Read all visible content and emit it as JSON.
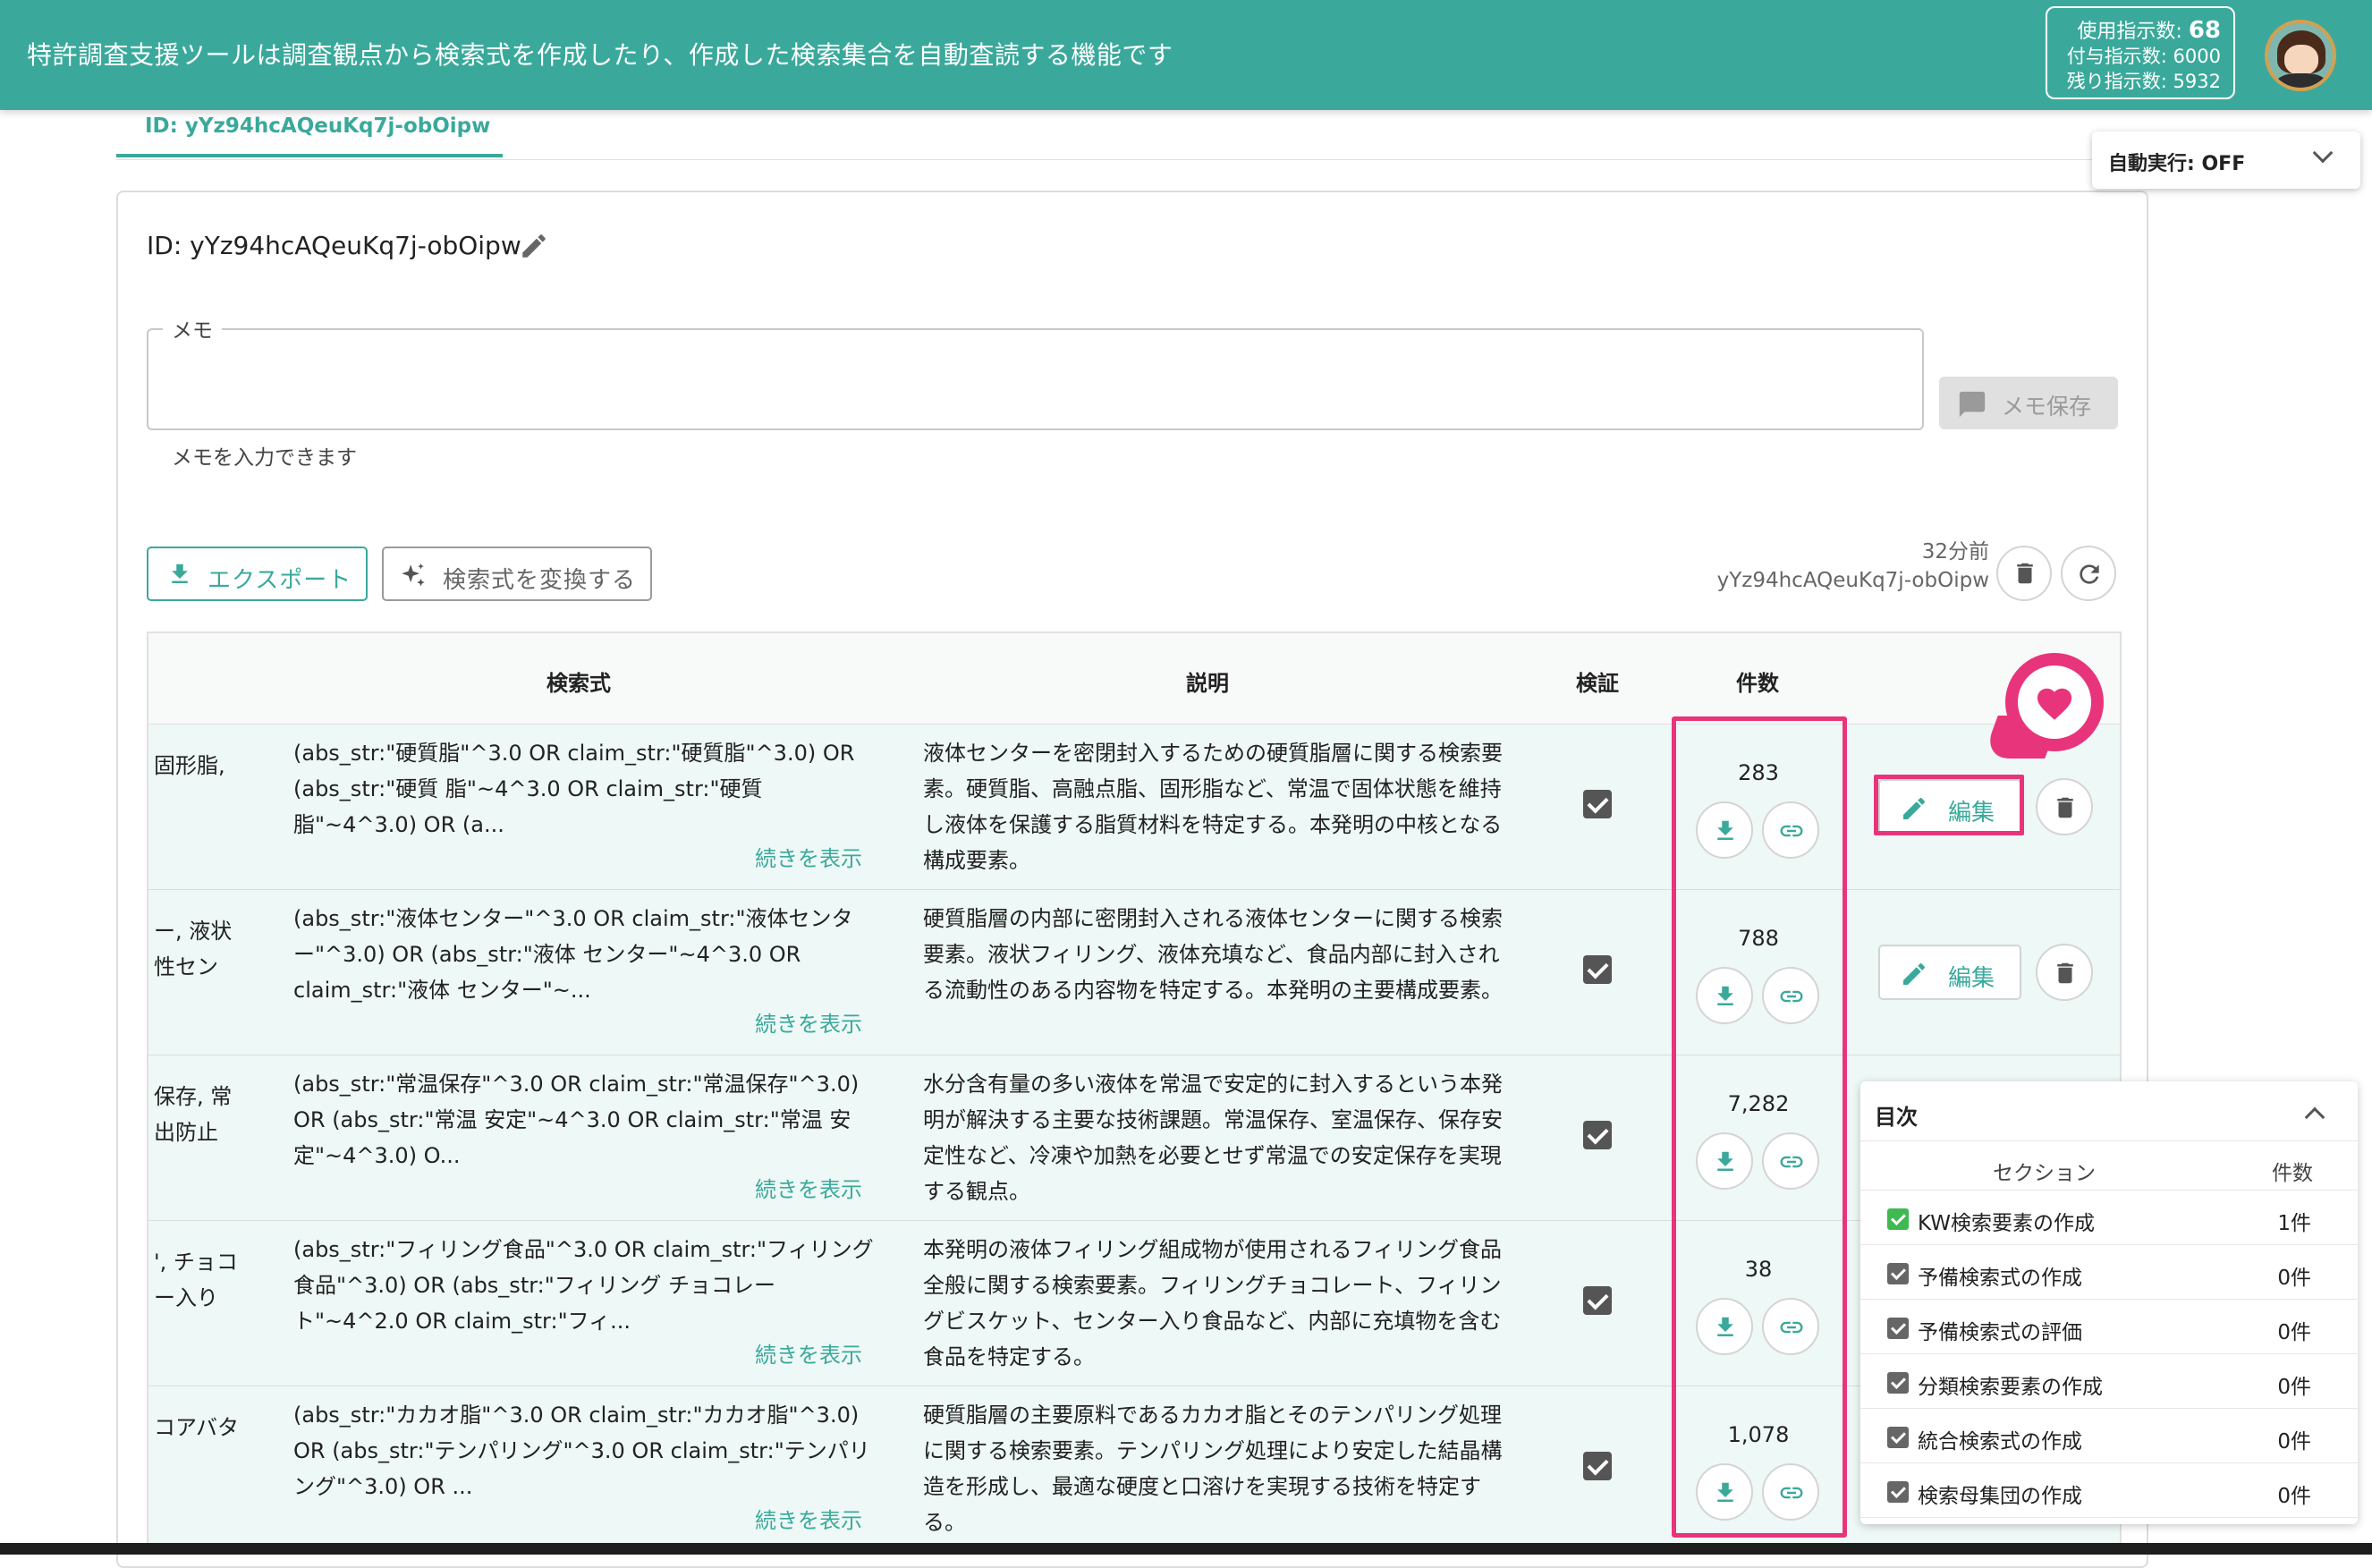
{
  "header": {
    "title": "特許調査支援ツールは調査観点から検索式を作成したり、作成した検索集合を自動査読する機能です",
    "usage_label": "使用指示数:",
    "usage_value": "68",
    "granted": "付与指示数: 6000",
    "remaining": "残り指示数: 5932",
    "color": "#3aa99b"
  },
  "tab": {
    "label": "ID: yYz94hcAQeuKq7j-obOipw"
  },
  "auto_exec": {
    "label": "自動実行: OFF"
  },
  "card": {
    "id_label": "ID: yYz94hcAQeuKq7j-obOipw",
    "memo_legend": "メモ",
    "memo_value": "",
    "memo_helper": "メモを入力できます",
    "memo_save": "メモ保存",
    "export": "エクスポート",
    "convert": "検索式を変換する",
    "time_ago": "32分前",
    "id_small": "yYz94hcAQeuKq7j-obOipw"
  },
  "table": {
    "headers": {
      "query": "検索式",
      "desc": "説明",
      "verify": "検証",
      "count": "件数"
    },
    "more_label": "続きを表示",
    "edit_label": "編集",
    "rows": [
      {
        "left": [
          "固形脂,",
          ""
        ],
        "query": "(abs_str:\"硬質脂\"^3.0 OR claim_str:\"硬質脂\"^3.0) OR (abs_str:\"硬質 脂\"~4^3.0 OR claim_str:\"硬質 脂\"~4^3.0) OR (a...",
        "desc": "液体センターを密閉封入するための硬質脂層に関する検索要素。硬質脂、高融点脂、固形脂など、常温で固体状態を維持し液体を保護する脂質材料を特定する。本発明の中核となる構成要素。",
        "verified": true,
        "count": "283"
      },
      {
        "left": [
          "ー, 液状",
          "性セン"
        ],
        "query": "(abs_str:\"液体センター\"^3.0 OR claim_str:\"液体センター\"^3.0) OR (abs_str:\"液体 センター\"~4^3.0 OR claim_str:\"液体 センター\"~...",
        "desc": "硬質脂層の内部に密閉封入される液体センターに関する検索要素。液状フィリング、液体充填など、食品内部に封入される流動性のある内容物を特定する。本発明の主要構成要素。",
        "verified": true,
        "count": "788"
      },
      {
        "left": [
          "保存, 常",
          "出防止"
        ],
        "query": "(abs_str:\"常温保存\"^3.0 OR claim_str:\"常温保存\"^3.0) OR (abs_str:\"常温 安定\"~4^3.0 OR claim_str:\"常温 安定\"~4^3.0) O...",
        "desc": "水分含有量の多い液体を常温で安定的に封入するという本発明が解決する主要な技術課題。常温保存、室温保存、保存安定性など、冷凍や加熱を必要とせず常温での安定保存を実現する観点。",
        "verified": true,
        "count": "7,282"
      },
      {
        "left": [
          "', チョコ",
          "ー入り"
        ],
        "query": "(abs_str:\"フィリング食品\"^3.0 OR claim_str:\"フィリング食品\"^3.0) OR (abs_str:\"フィリング チョコレート\"~4^2.0 OR claim_str:\"フィ...",
        "desc": "本発明の液体フィリング組成物が使用されるフィリング食品全般に関する検索要素。フィリングチョコレート、フィリングビスケット、センター入り食品など、内部に充填物を含む食品を特定する。",
        "verified": true,
        "count": "38"
      },
      {
        "left": [
          "コアバタ",
          ""
        ],
        "query": "(abs_str:\"カカオ脂\"^3.0 OR claim_str:\"カカオ脂\"^3.0) OR (abs_str:\"テンパリング\"^3.0 OR claim_str:\"テンパリング\"^3.0) OR ...",
        "desc": "硬質脂層の主要原料であるカカオ脂とそのテンパリング処理に関する検索要素。テンパリング処理により安定した結晶構造を形成し、最適な硬度と口溶けを実現する技術を特定する。",
        "verified": true,
        "count": "1,078"
      }
    ]
  },
  "toc": {
    "title": "目次",
    "col_section": "セクション",
    "col_count": "件数",
    "items": [
      {
        "label": "KW検索要素の作成",
        "count": "1件",
        "status": "done"
      },
      {
        "label": "予備検索式の作成",
        "count": "0件",
        "status": "checked"
      },
      {
        "label": "予備検索式の評価",
        "count": "0件",
        "status": "checked"
      },
      {
        "label": "分類検索要素の作成",
        "count": "0件",
        "status": "checked"
      },
      {
        "label": "統合検索式の作成",
        "count": "0件",
        "status": "checked"
      },
      {
        "label": "検索母集団の作成",
        "count": "0件",
        "status": "checked"
      }
    ]
  },
  "colors": {
    "accent": "#3aa99b",
    "highlight": "#e8347a",
    "row_bg": "#eef8f6"
  }
}
